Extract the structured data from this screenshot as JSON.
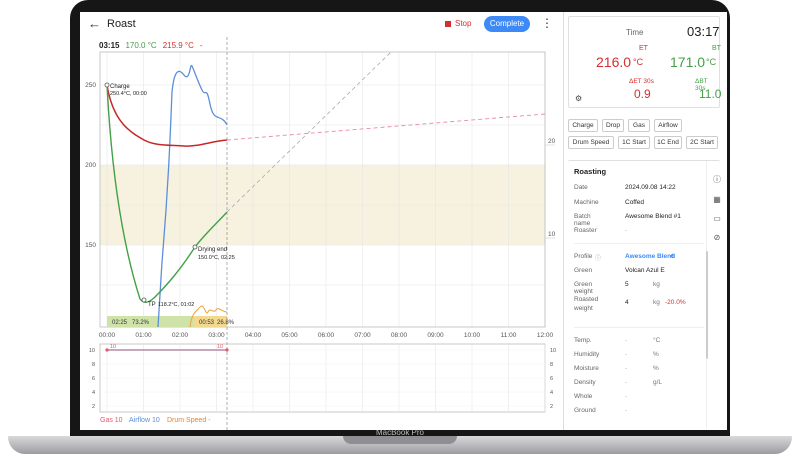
{
  "device": {
    "brand": "MacBook Pro"
  },
  "header": {
    "title": "Roast",
    "stop_label": "Stop",
    "complete_label": "Complete"
  },
  "readout": {
    "time": "03:15",
    "bt": "170.0 °C",
    "et": "215.9 °C",
    "ror": "-"
  },
  "chart_data": {
    "type": "line",
    "x_ticks": [
      "00:00",
      "01:00",
      "02:00",
      "03:00",
      "04:00",
      "05:00",
      "06:00",
      "07:00",
      "08:00",
      "09:00",
      "10:00",
      "11:00",
      "12:00"
    ],
    "y_ticks_left": [
      "250",
      "200",
      "150"
    ],
    "y_ticks_right": [
      "20",
      "10"
    ],
    "series": [
      {
        "name": "ET",
        "color": "#c62828"
      },
      {
        "name": "BT",
        "color": "#43a047"
      },
      {
        "name": "Airflow",
        "color": "#5b8fd9"
      },
      {
        "name": "Drum Speed",
        "color": "#e8a33b"
      }
    ],
    "annotations": [
      {
        "label": "Charge",
        "detail": "250.4°C, 00:00"
      },
      {
        "label": "Drying end",
        "detail": "150.0°C, 02:25"
      },
      {
        "label": "TP",
        "detail": "118.2°C, 01:02"
      }
    ],
    "phases": [
      {
        "time": "02:25",
        "percent": "73.2%",
        "color": "#cfe3a8"
      },
      {
        "time": "00:53",
        "percent": "26.8%",
        "color": "#f3d88f"
      }
    ]
  },
  "control_chart": {
    "y_ticks": [
      "10",
      "8",
      "6",
      "4",
      "2"
    ],
    "gas_marker": "10",
    "legend": [
      {
        "label": "Gas 10",
        "color": "#e05a6a"
      },
      {
        "label": "Airflow 10",
        "color": "#5b8fd9"
      },
      {
        "label": "Drum Speed -",
        "color": "#e8832b"
      }
    ]
  },
  "metrics": {
    "time_label": "Time",
    "time_value": "03:17",
    "et_label": "ET",
    "et_value": "216.0",
    "et_unit": "°C",
    "bt_label": "BT",
    "bt_value": "171.0",
    "bt_unit": "°C",
    "det_label": "ΔET 30s",
    "det_value": "0.9",
    "dbt_label": "ΔBT 30s",
    "dbt_value": "11.0"
  },
  "events": [
    "Charge",
    "Drop",
    "Gas",
    "Airflow",
    "Drum Speed",
    "1C Start",
    "1C End",
    "2C Start"
  ],
  "roasting": {
    "title": "Roasting",
    "date_label": "Date",
    "date_value": "2024.09.08 14:22",
    "machine_label": "Machine",
    "machine_value": "Coffed",
    "batch_label": "Batch name",
    "batch_value": "Awesome Blend #1",
    "roaster_label": "Roaster",
    "roaster_value": "-",
    "profile_label": "Profile",
    "profile_value": "Awesome Blend",
    "green_label": "Green",
    "green_value": "Volcan Azul E",
    "gw_label": "Green weight",
    "gw_value": "5",
    "gw_unit": "kg",
    "rw_label": "Roasted weight",
    "rw_value": "4",
    "rw_unit": "kg",
    "rw_pct": "-20.0%",
    "temp_label": "Temp.",
    "temp_value": "-",
    "temp_unit": "°C",
    "hum_label": "Humidity",
    "hum_value": "-",
    "hum_unit": "%",
    "moist_label": "Moisture",
    "moist_value": "-",
    "moist_unit": "%",
    "dens_label": "Density",
    "dens_value": "-",
    "dens_unit": "g/L",
    "whole_label": "Whole",
    "whole_value": "-",
    "ground_label": "Ground",
    "ground_value": "-"
  }
}
